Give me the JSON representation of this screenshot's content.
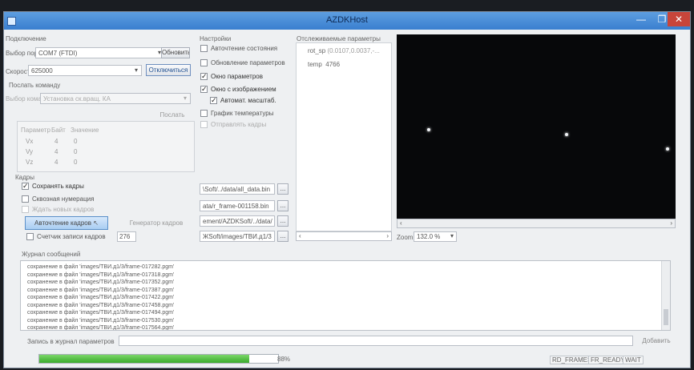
{
  "window": {
    "title": "AZDKHost",
    "min_label": "—",
    "max_label": "❐",
    "close_label": "✕"
  },
  "connection": {
    "group_label": "Подключение",
    "port_label": "Выбор порта",
    "port_value": "COM7 (FTDI)",
    "refresh_button": "Обновить",
    "speed_label": "Скорость",
    "speed_value": "625000",
    "disconnect_button": "Отключиться"
  },
  "command": {
    "group_label": "Послать команду",
    "select_label": "Выбор команды",
    "select_value": "Установка ск.вращ. КА",
    "send_button": "Послать",
    "table_headers": [
      "Параметр",
      "Байт",
      "Значение"
    ],
    "rows": [
      {
        "param": "Vx",
        "bytes": "4",
        "value": "0"
      },
      {
        "param": "Vy",
        "bytes": "4",
        "value": "0"
      },
      {
        "param": "Vz",
        "bytes": "4",
        "value": "0"
      }
    ]
  },
  "frames": {
    "group_label": "Кадры",
    "save_frames": "Сохранять кадры",
    "through_numbering": "Сквозная нумерация",
    "wait_new": "Ждать новых кадров",
    "autoread_button": "Авточтение кадров",
    "generator_button": "Генератор кадров",
    "counter_label": "Счетчик записи кадров",
    "counter_value": "276"
  },
  "paths": {
    "p1": "\\Soft/../data/all_data.bin",
    "p2": "ata/r_frame-001158.bin",
    "p3": "ement/AZDKSoft/../data/",
    "p4": "ЖSoft/images/ТВИ.д1/3",
    "browse": "..."
  },
  "settings": {
    "group_label": "Настройки",
    "items": [
      {
        "label": "Авточтение состояния",
        "checked": false
      },
      {
        "label": "Обновление параметров",
        "checked": false
      },
      {
        "label": "Окно параметров",
        "checked": true
      },
      {
        "label": "Окно с изображением",
        "checked": true
      },
      {
        "label": "Автомат. масштаб.",
        "checked": true
      },
      {
        "label": "График температуры",
        "checked": false
      },
      {
        "label": "Отправлять кадры",
        "checked": false
      }
    ]
  },
  "tracked": {
    "group_label": "Отслеживаемые параметры",
    "items": [
      {
        "name": "rot_sp",
        "value": "(0.0107,0.0037,-..."
      },
      {
        "name": "temp",
        "value": "4766"
      }
    ]
  },
  "image_view": {
    "zoom_label": "Zoom",
    "zoom_value": "132.0 %"
  },
  "journal": {
    "group_label": "Журнал сообщений",
    "lines": [
      "сохранение в файл 'images/ТВИ.д1/3/frame-017282.pgm'",
      "сохранение в файл 'images/ТВИ.д1/3/frame-017318.pgm'",
      "сохранение в файл 'images/ТВИ.д1/3/frame-017352.pgm'",
      "сохранение в файл 'images/ТВИ.д1/3/frame-017387.pgm'",
      "сохранение в файл 'images/ТВИ.д1/3/frame-017422.pgm'",
      "сохранение в файл 'images/ТВИ.д1/3/frame-017458.pgm'",
      "сохранение в файл 'images/ТВИ.д1/3/frame-017494.pgm'",
      "сохранение в файл 'images/ТВИ.д1/3/frame-017530.pgm'",
      "сохранение в файл 'images/ТВИ.д1/3/frame-017564.pgm'"
    ],
    "param_log_label": "Запись в журнал параметров",
    "add_button": "Добавить"
  },
  "status": {
    "progress_percent": 88,
    "progress_text": "88%",
    "flags": [
      "RD_FRAMES",
      "FR_READY",
      "WAIT"
    ]
  },
  "colors": {
    "progress": "#3aac2c",
    "titlebar": "#3a7fcf",
    "close": "#c8453a"
  }
}
